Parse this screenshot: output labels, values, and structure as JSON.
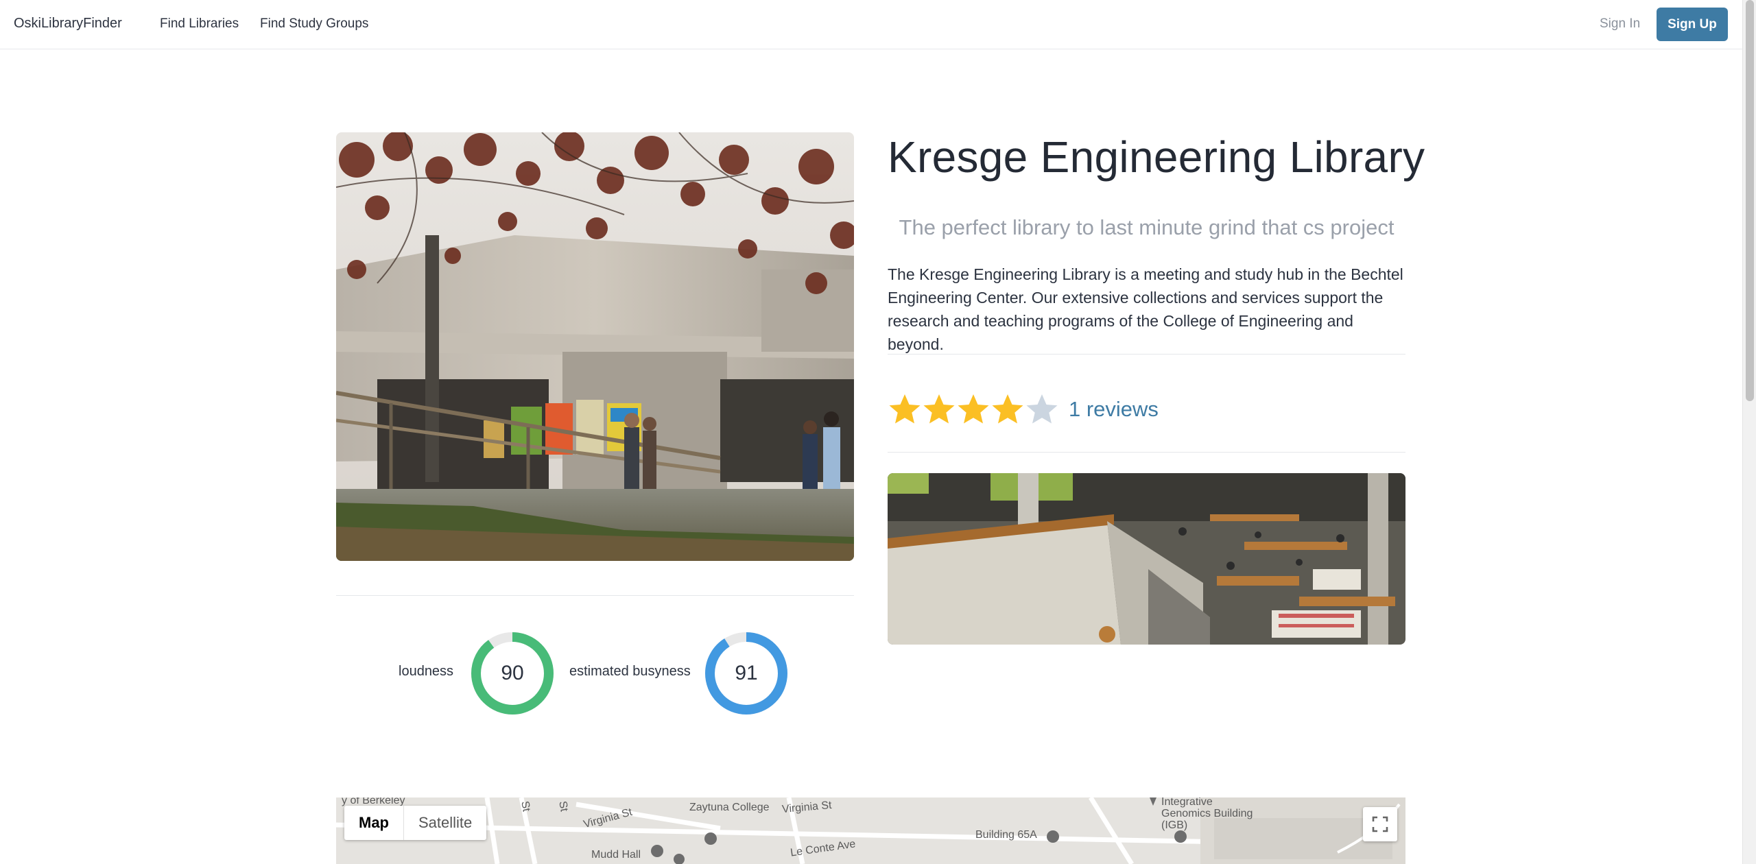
{
  "nav": {
    "brand": "OskiLibraryFinder",
    "links": [
      "Find Libraries",
      "Find Study Groups"
    ],
    "sign_in": "Sign In",
    "sign_up": "Sign Up"
  },
  "library": {
    "name": "Kresge Engineering Library",
    "tagline": "The perfect library to last minute grind that cs project",
    "description": "The Kresge Engineering Library is a meeting and study hub in the Bechtel Engineering Center. Our extensive collections and services support the research and teaching programs of the College of Engineering and beyond.",
    "rating": 4,
    "max_rating": 5,
    "reviews_text": "1 reviews"
  },
  "metrics": [
    {
      "label": "loudness",
      "value": "90",
      "percent": 90,
      "color": "#48bb78"
    },
    {
      "label": "estimated busyness",
      "value": "91",
      "percent": 91,
      "color": "#4299e1"
    }
  ],
  "map": {
    "modes": [
      "Map",
      "Satellite"
    ],
    "active_mode": "Map",
    "places": [
      "y of Berkeley",
      "Virginia St",
      "Zaytuna College",
      "Virginia St",
      "Integrative Genomics Building (IGB)",
      "Building 65A",
      "Mudd Hall",
      "Le Conte Ave",
      "St",
      "St"
    ]
  },
  "colors": {
    "accent": "#3e7ba4",
    "star_on": "#fbbf24",
    "star_off": "#cbd5e0"
  }
}
